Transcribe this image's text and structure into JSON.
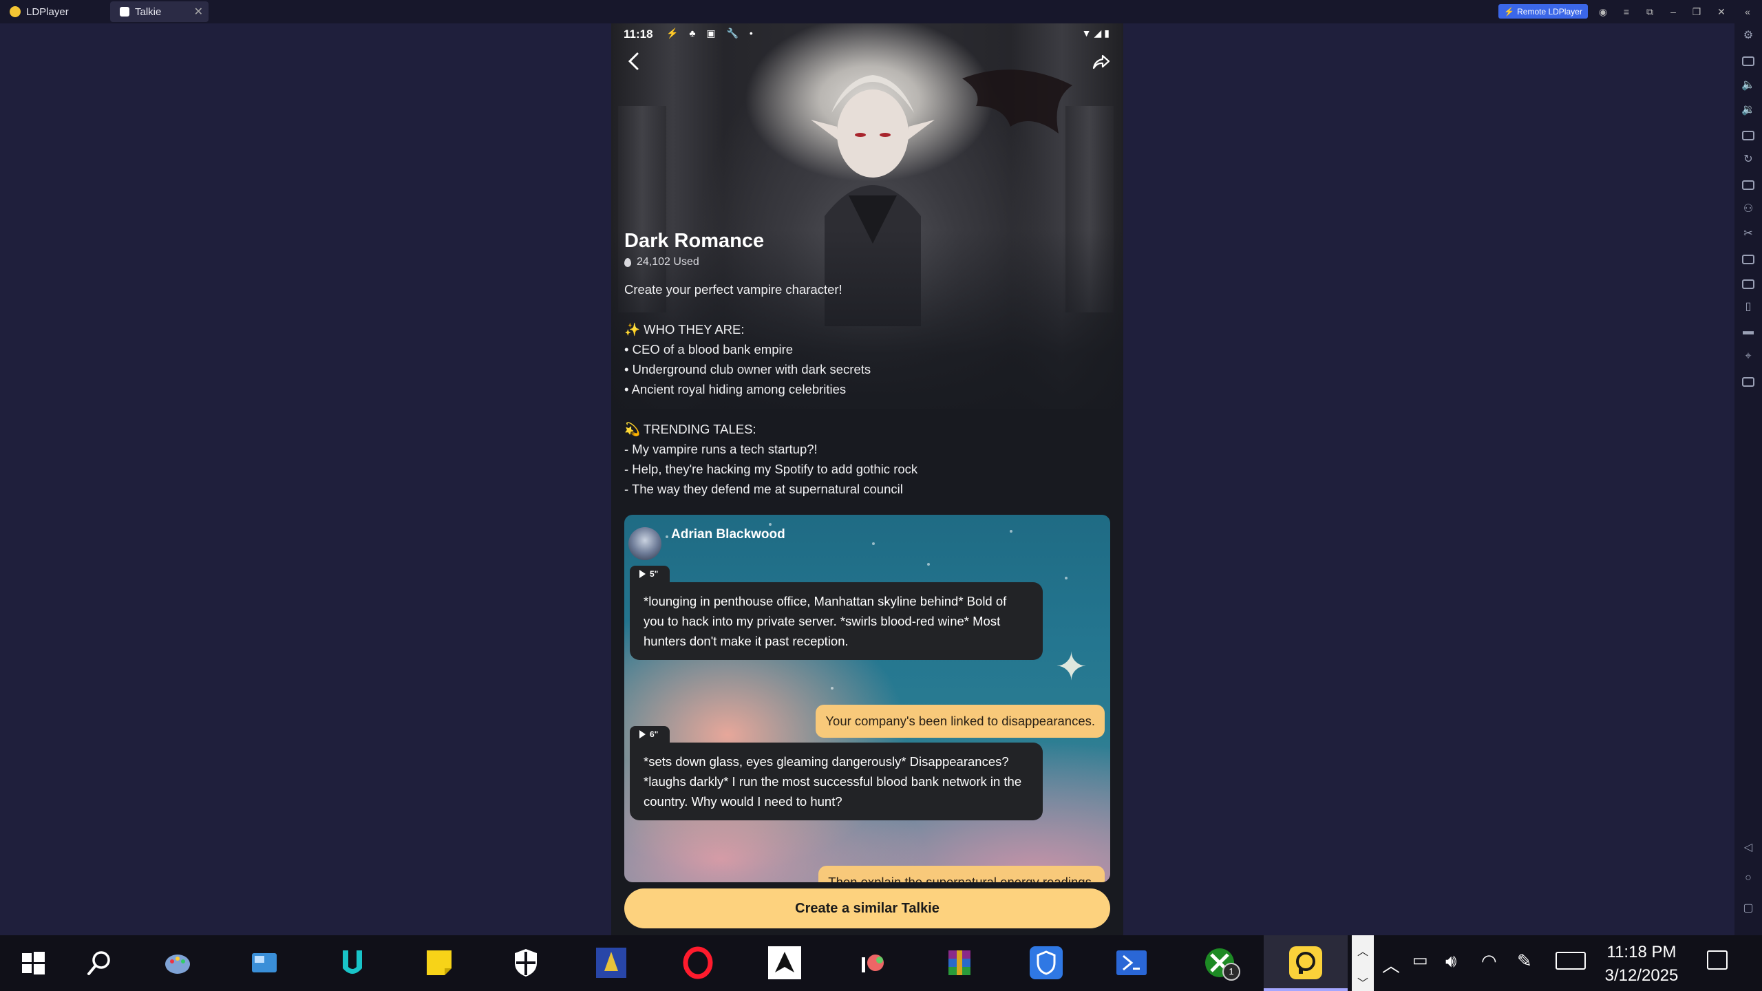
{
  "window": {
    "tabs": [
      {
        "label": "LDPlayer"
      },
      {
        "label": "Talkie"
      }
    ],
    "remote_label": "Remote LDPlayer"
  },
  "phone": {
    "status_time": "11:18",
    "talkie": {
      "title": "Dark Romance",
      "used": "24,102 Used",
      "description": [
        "Create your perfect vampire character!",
        "",
        "✨ WHO THEY ARE:",
        "• CEO of a blood bank empire",
        "• Underground club owner with dark secrets",
        "• Ancient royal hiding among celebrities",
        "",
        "💫 TRENDING TALES:",
        "- My vampire runs a tech startup?!",
        "- Help, they're hacking my Spotify to add gothic rock",
        "- The way they defend me at supernatural council"
      ],
      "chat": {
        "character_name": "Adrian Blackwood",
        "messages": [
          {
            "role": "character",
            "voice": "5\"",
            "text": "*lounging in penthouse office, Manhattan skyline behind* Bold of you to hack into my private server. *swirls blood-red wine* Most hunters don't make it past reception."
          },
          {
            "role": "user",
            "text": "Your company's been linked to disappearances."
          },
          {
            "role": "character",
            "voice": "6\"",
            "text": "*sets down glass, eyes gleaming dangerously* Disappearances? *laughs darkly* I run the most successful blood bank network in the country. Why would I need to hunt?"
          },
          {
            "role": "user",
            "text": "Then explain the supernatural energy readings."
          }
        ]
      },
      "create_button": "Create a similar Talkie"
    }
  },
  "taskbar": {
    "time": "11:18 PM",
    "date": "3/12/2025",
    "xbox_badge": "1"
  },
  "colors": {
    "accent_button": "#fdd27e",
    "user_bubble": "#f8c97a",
    "bot_bubble": "#222326",
    "remote_button": "#3b67e8"
  }
}
